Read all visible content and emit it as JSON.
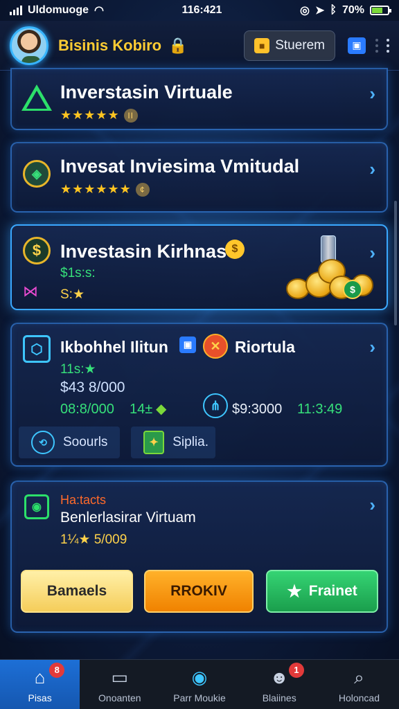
{
  "status_bar": {
    "carrier": "Uldomuoge",
    "time": "116:421",
    "battery": "70%",
    "battery_level": 0.7
  },
  "header": {
    "title": "Bisinis Kobiro",
    "store_label": "Stuerem"
  },
  "cards": [
    {
      "title": "Inverstasin Virtuale",
      "stars": "★★★★★",
      "coin": "II"
    },
    {
      "title": "Invesat Inviesima Vmitudal",
      "stars": "★★★★★★",
      "coin": "¢"
    },
    {
      "title": "Investasin Kirhnas",
      "line1": "$1s:s:",
      "line2": "S:★"
    },
    {
      "title": "Ikbohhel Ilitun",
      "title2": "Riortula",
      "line1": "11s:★",
      "line2": "$43 8/000",
      "row_a": "08:8/000",
      "row_b": "14±",
      "row_c": "$9:3000",
      "row_d": "11:3:49",
      "btn_a": "Soourls",
      "btn_b": "Siplia."
    },
    {
      "heading": "Ha:tacts",
      "title": "Benlerlasirar Virtuam",
      "line": "1¼★ 5/009",
      "btn_1": "Bamaels",
      "btn_2": "RROKIV",
      "btn_3": "Frainet"
    }
  ],
  "nav": {
    "items": [
      {
        "label": "Pisas",
        "badge": "8"
      },
      {
        "label": "Onoanten"
      },
      {
        "label": "Parr Moukie"
      },
      {
        "label": "Blaiines",
        "badge": "1"
      },
      {
        "label": "Holoncad"
      }
    ]
  },
  "colors": {
    "accent": "#2aa7ff",
    "gold": "#ffcc33",
    "green": "#36e07a",
    "orange": "#ff9a0a"
  }
}
